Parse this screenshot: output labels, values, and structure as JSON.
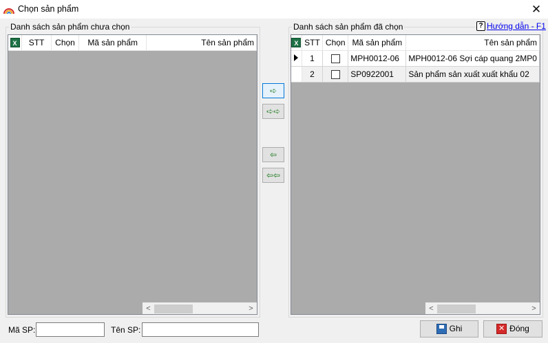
{
  "window": {
    "title": "Chọn sản phẩm",
    "close_glyph": "✕",
    "icon": "rainbow-app-icon"
  },
  "left_panel": {
    "legend": "Danh sách sản phẩm chưa chọn",
    "export_icon": "X",
    "columns": [
      "STT",
      "Chọn",
      "Mã sản phẩm",
      "Tên sản phẩm"
    ],
    "rows": []
  },
  "right_panel": {
    "legend": "Danh sách sản phẩm đã chọn",
    "export_icon": "X",
    "columns": [
      "STT",
      "Chọn",
      "Mã sản phẩm",
      "Tên sản phẩm"
    ],
    "rows": [
      {
        "stt": "1",
        "checked": false,
        "ma": "MPH0012-06",
        "ten": "MPH0012-06 Sợi cáp quang 2MP0"
      },
      {
        "stt": "2",
        "checked": false,
        "ma": "SP0922001",
        "ten": "Sản phẩm sản xuất xuất khẩu 02"
      }
    ]
  },
  "help": {
    "icon": "?",
    "label": "Hướng dẫn - F1"
  },
  "move_buttons": {
    "add_one": "➪",
    "add_all": "➪➪",
    "remove_one": "⇦",
    "remove_all": "⇦⇦"
  },
  "scroll": {
    "left": "<",
    "right": ">"
  },
  "filter": {
    "ma_label": "Mã SP:",
    "ma_value": "",
    "ten_label": "Tên SP:",
    "ten_value": ""
  },
  "buttons": {
    "save_label": "Ghi",
    "close_label": "Đóng",
    "close_icon": "✕"
  }
}
